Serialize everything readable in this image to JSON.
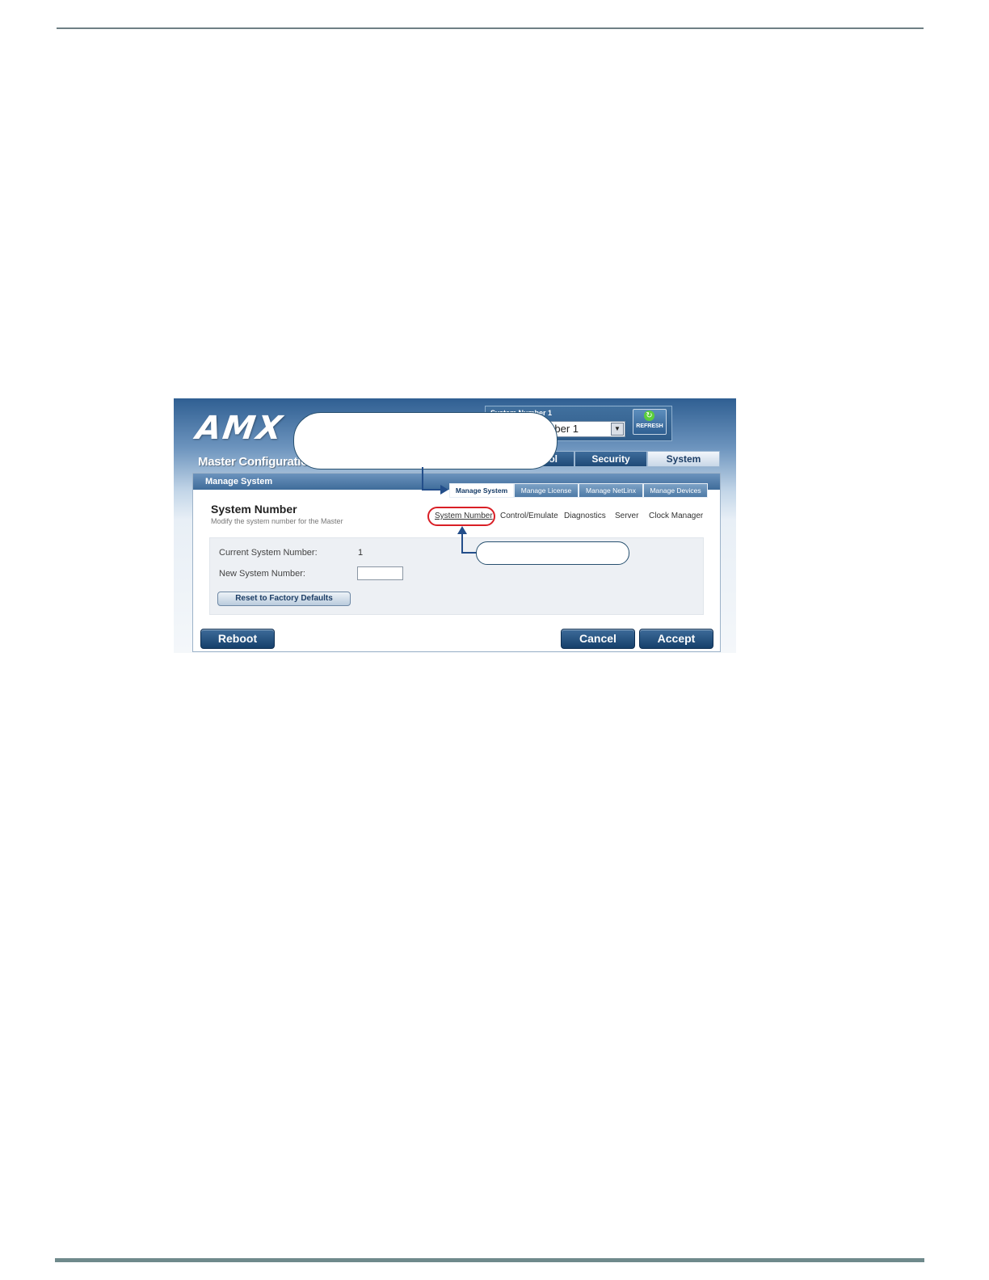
{
  "app": {
    "logo_text": "AMX",
    "master_title": "Master Configuration",
    "system_label": "System Number 1",
    "system_select_value": "System Number 1",
    "refresh_label": "REFRESH"
  },
  "main_tabs": [
    "Security",
    "System"
  ],
  "partial_tab_text": "ol",
  "panel": {
    "header": "Manage System",
    "subtabs": [
      "Manage System",
      "Manage License",
      "Manage NetLinx",
      "Manage Devices"
    ],
    "section_title": "System Number",
    "section_subtitle": "Modify the system number for the Master",
    "subnav": [
      "System Number",
      "Control/Emulate",
      "Diagnostics",
      "Server",
      "Clock Manager"
    ],
    "form": {
      "current_label": "Current System Number:",
      "current_value": "1",
      "new_label": "New System Number:",
      "new_value": "",
      "reset_button": "Reset to Factory Defaults"
    },
    "buttons": {
      "reboot": "Reboot",
      "cancel": "Cancel",
      "accept": "Accept"
    }
  },
  "colors": {
    "accent": "#2f5f92",
    "highlight_ring": "#d91f26",
    "leader": "#234e8a"
  },
  "icons": [
    "refresh-icon",
    "dropdown-arrow-icon"
  ]
}
